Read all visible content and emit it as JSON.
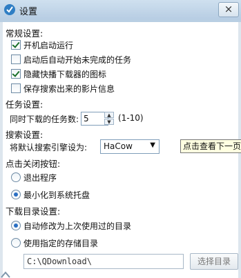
{
  "window": {
    "title": "设置",
    "close_symbol": "×"
  },
  "general": {
    "heading": "常规设置:",
    "options": [
      {
        "label": "开机启动运行",
        "checked": true
      },
      {
        "label": "启动后自动开始未完成的任务",
        "checked": false
      },
      {
        "label": "隐藏快播下载器的图标",
        "checked": true
      },
      {
        "label": "保存搜索出来的影片信息",
        "checked": false
      }
    ]
  },
  "tasks": {
    "heading": "任务设置:",
    "concurrent_label": "同时下载的任务数:",
    "concurrent_value": "5",
    "range_hint": "(1-10)"
  },
  "search": {
    "heading": "搜索设置:",
    "engine_label": "将默认搜索引擎设为:",
    "engine_value": "HaCow",
    "tooltip": "点击查看下一页"
  },
  "close_action": {
    "heading": "点击关闭按钮:",
    "options": [
      {
        "label": "退出程序",
        "selected": false
      },
      {
        "label": "最小化到系统托盘",
        "selected": true
      }
    ]
  },
  "download_dir": {
    "heading": "下载目录设置:",
    "options": [
      {
        "label": "自动修改为上次使用过的目录",
        "selected": true
      },
      {
        "label": "使用指定的存储目录",
        "selected": false
      }
    ],
    "path_value": "C:\\QDownload\\",
    "browse_label": "选择目录"
  },
  "icons": {
    "app": "qvod-download-icon",
    "spin_up": "▲",
    "spin_down": "▼",
    "dropdown": "▼"
  }
}
